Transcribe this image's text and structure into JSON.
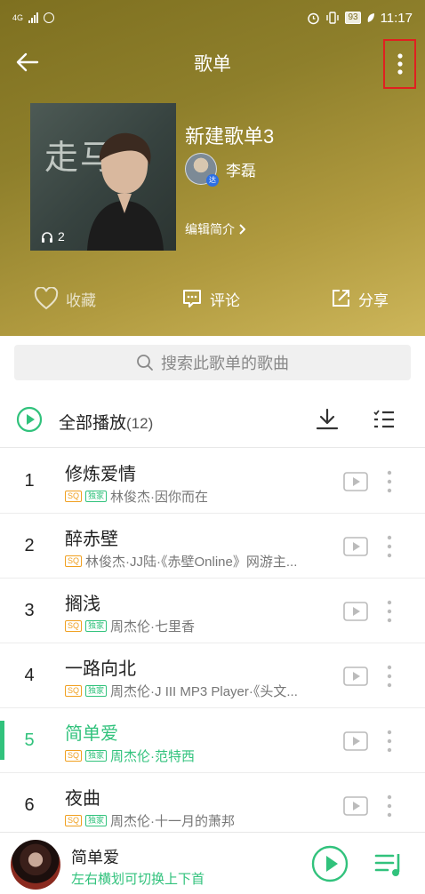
{
  "status_bar": {
    "network": "4G",
    "battery": "93",
    "time": "11:17"
  },
  "top_bar": {
    "title": "歌单"
  },
  "playlist": {
    "name": "新建歌单3",
    "cover_text": "走马",
    "play_count": "2",
    "creator_name": "李磊",
    "creator_badge": "达",
    "edit_intro": "编辑简介"
  },
  "actions": {
    "favorite": "收藏",
    "comment": "评论",
    "share": "分享"
  },
  "search": {
    "placeholder": "搜索此歌单的歌曲"
  },
  "play_all": {
    "label": "全部播放",
    "count": "(12)"
  },
  "tags": {
    "sq": "SQ",
    "exclusive": "独家"
  },
  "songs": [
    {
      "index": "1",
      "title": "修炼爱情",
      "artist": "林俊杰·因你而在",
      "exclusive": true,
      "active": false
    },
    {
      "index": "2",
      "title": "醉赤壁",
      "artist": "林俊杰·JJ陆·《赤壁Online》网游主...",
      "exclusive": false,
      "active": false
    },
    {
      "index": "3",
      "title": "搁浅",
      "artist": "周杰伦·七里香",
      "exclusive": true,
      "active": false
    },
    {
      "index": "4",
      "title": "一路向北",
      "artist": "周杰伦·J III MP3 Player·《头文...",
      "exclusive": true,
      "active": false
    },
    {
      "index": "5",
      "title": "简单爱",
      "artist": "周杰伦·范特西",
      "exclusive": true,
      "active": true
    },
    {
      "index": "6",
      "title": "夜曲",
      "artist": "周杰伦·十一月的萧邦",
      "exclusive": true,
      "active": false
    }
  ],
  "mini_player": {
    "title": "简单爱",
    "hint": "左右横划可切换上下首"
  },
  "colors": {
    "accent": "#31c27c",
    "sq_tag": "#f0a020",
    "header_gold": "#b09a3f",
    "highlight_box": "#e02020"
  }
}
